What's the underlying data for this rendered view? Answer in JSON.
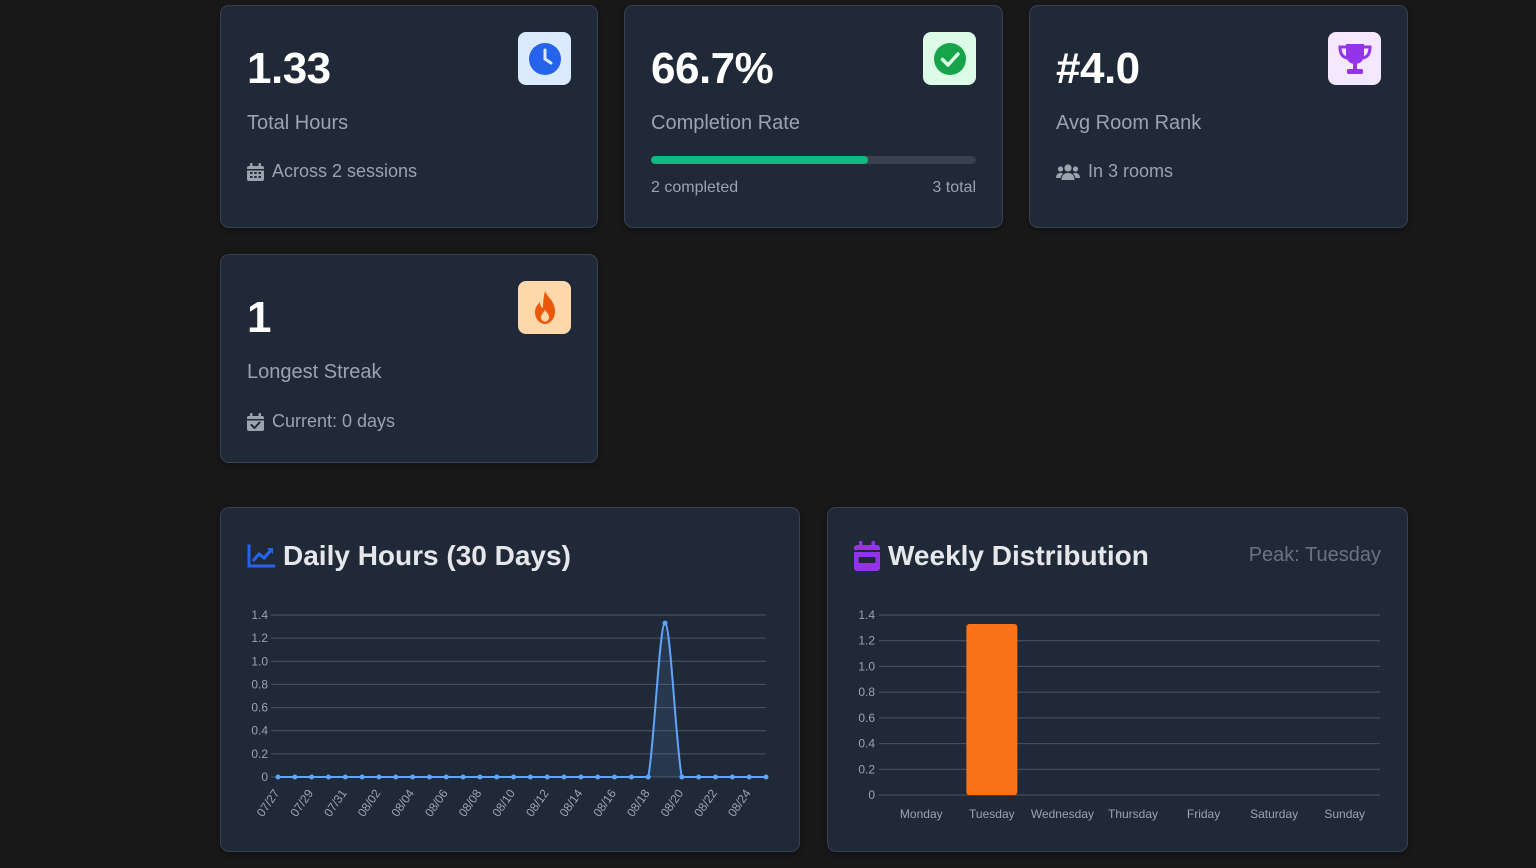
{
  "stats": {
    "total_hours": {
      "value": "1.33",
      "label": "Total Hours",
      "sub": "Across 2 sessions",
      "icon": "clock-icon",
      "icon_bg": "#dbeafe",
      "icon_color": "#2563eb"
    },
    "completion": {
      "value": "66.7%",
      "label": "Completion Rate",
      "progress": 0.667,
      "completed": "2 completed",
      "total": "3 total",
      "icon": "check-circle-icon",
      "icon_bg": "#dcfce7",
      "icon_color": "#16a34a",
      "bar_color": "#10b981"
    },
    "room_rank": {
      "value": "#4.0",
      "label": "Avg Room Rank",
      "sub": "In 3 rooms",
      "icon": "trophy-icon",
      "icon_bg": "#f3e8ff",
      "icon_color": "#9333ea"
    },
    "streak": {
      "value": "1",
      "label": "Longest Streak",
      "sub": "Current: 0 days",
      "icon": "fire-icon",
      "icon_bg": "#fed7aa",
      "icon_color": "#ea580c"
    }
  },
  "daily_chart": {
    "title": "Daily Hours (30 Days)",
    "icon": "line-chart-icon",
    "color": "#60a5fa"
  },
  "weekly_chart": {
    "title": "Weekly Distribution",
    "peak": "Peak: Tuesday",
    "icon": "calendar-icon",
    "color": "#f97316"
  },
  "chart_data": [
    {
      "type": "line",
      "title": "Daily Hours (30 Days)",
      "x": [
        "07/27",
        "07/28",
        "07/29",
        "07/30",
        "07/31",
        "08/01",
        "08/02",
        "08/03",
        "08/04",
        "08/05",
        "08/06",
        "08/07",
        "08/08",
        "08/09",
        "08/10",
        "08/11",
        "08/12",
        "08/13",
        "08/14",
        "08/15",
        "08/16",
        "08/17",
        "08/18",
        "08/19",
        "08/20",
        "08/21",
        "08/22",
        "08/23",
        "08/24",
        "08/25"
      ],
      "x_tick_labels": [
        "07/27",
        "07/29",
        "07/31",
        "08/02",
        "08/04",
        "08/06",
        "08/08",
        "08/10",
        "08/12",
        "08/14",
        "08/16",
        "08/18",
        "08/20",
        "08/22",
        "08/24"
      ],
      "series": [
        {
          "values": [
            0,
            0,
            0,
            0,
            0,
            0,
            0,
            0,
            0,
            0,
            0,
            0,
            0,
            0,
            0,
            0,
            0,
            0,
            0,
            0,
            0,
            0,
            0,
            1.33,
            0,
            0,
            0,
            0,
            0,
            0
          ]
        }
      ],
      "ylim": [
        0,
        1.4
      ],
      "yticks": [
        "0",
        "0.2",
        "0.4",
        "0.6",
        "0.8",
        "1.0",
        "1.2",
        "1.4"
      ],
      "grid": true
    },
    {
      "type": "bar",
      "title": "Weekly Distribution",
      "categories": [
        "Monday",
        "Tuesday",
        "Wednesday",
        "Thursday",
        "Friday",
        "Saturday",
        "Sunday"
      ],
      "values": [
        0,
        1.33,
        0,
        0,
        0,
        0,
        0
      ],
      "ylim": [
        0,
        1.4
      ],
      "yticks": [
        "0",
        "0.2",
        "0.4",
        "0.6",
        "0.8",
        "1.0",
        "1.2",
        "1.4"
      ],
      "grid": true
    }
  ]
}
